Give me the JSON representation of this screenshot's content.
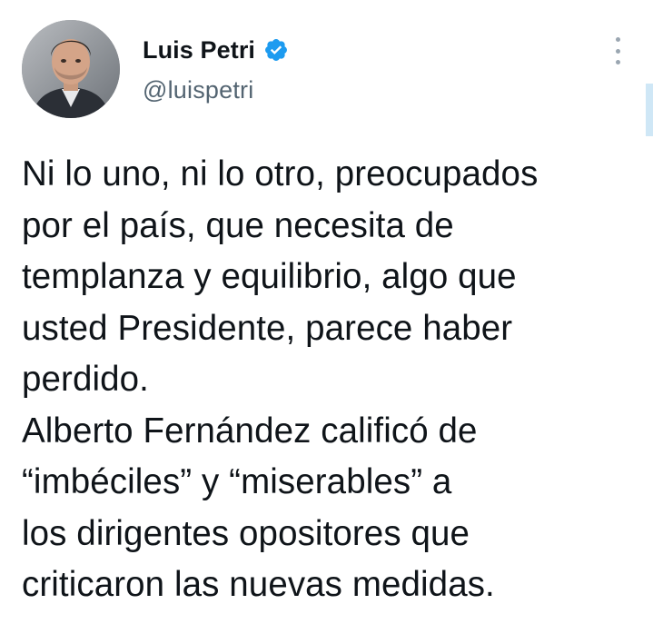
{
  "author": {
    "display_name": "Luis Petri",
    "handle": "@luispetri",
    "verified": true,
    "avatar_icon": "profile-photo",
    "verified_icon": "verified-badge-icon"
  },
  "menu": {
    "icon": "more-vertical-icon"
  },
  "tweet": {
    "lines": [
      "Ni lo uno, ni lo otro, preocupados",
      "por el país, que necesita de",
      "templanza y equilibrio, algo que",
      "usted Presidente, parece haber",
      "perdido.",
      "Alberto Fernández calificó de",
      "“imbéciles” y “miserables” a",
      "los dirigentes opositores que",
      "criticaron las nuevas medidas."
    ]
  },
  "colors": {
    "verified_blue": "#1d9bf0",
    "handle_gray": "#536471",
    "text": "#0f1419"
  }
}
